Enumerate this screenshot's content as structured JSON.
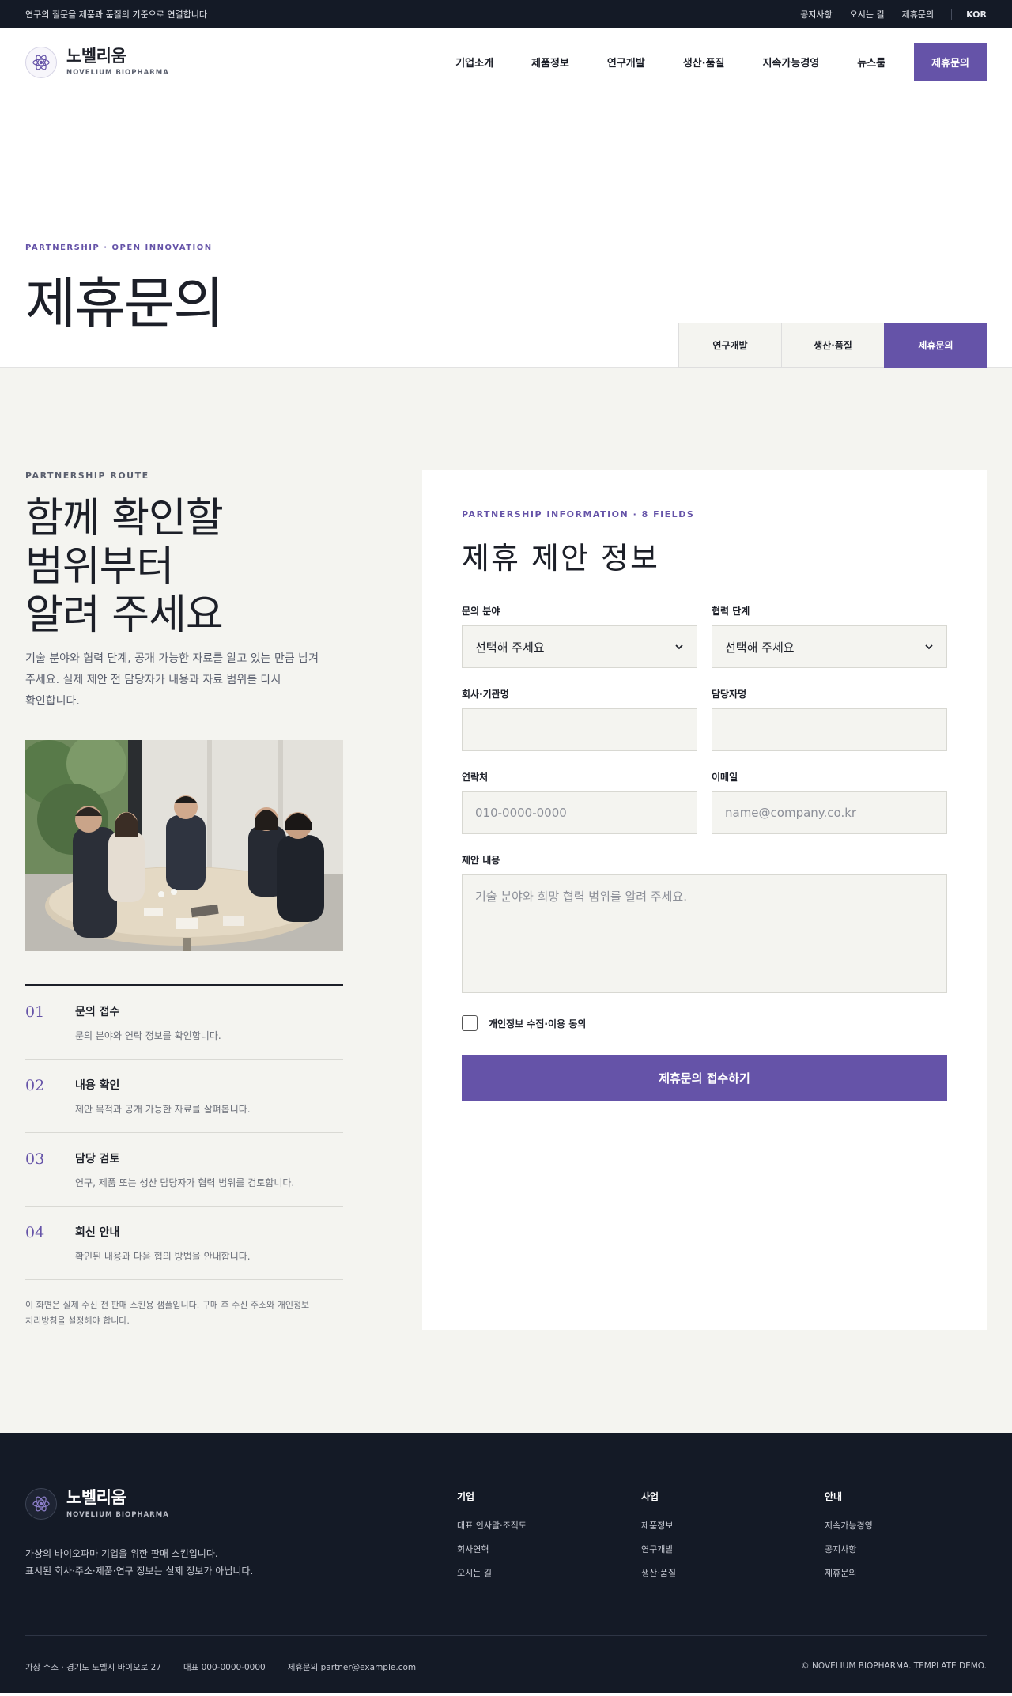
{
  "topbar": {
    "tagline": "연구의 질문을 제품과 품질의 기준으로 연결합니다",
    "links": [
      "공지사항",
      "오시는 길",
      "제휴문의"
    ],
    "lang": "KOR"
  },
  "header": {
    "brand_name": "노벨리움",
    "brand_sub": "NOVELIUM BIOPHARMA",
    "nav": [
      "기업소개",
      "제품정보",
      "연구개발",
      "생산·품질",
      "지속가능경영",
      "뉴스룸"
    ],
    "cta": "제휴문의"
  },
  "hero": {
    "eyebrow": "PARTNERSHIP · OPEN INNOVATION",
    "title": "제휴문의",
    "subtabs": [
      "연구개발",
      "생산·품질",
      "제휴문의"
    ]
  },
  "left": {
    "eyebrow": "PARTNERSHIP ROUTE",
    "heading_lines": [
      "함께 확인할",
      "범위부터",
      "알려 주세요"
    ],
    "desc_lines": [
      "기술 분야와 협력 단계, 공개 가능한 자료를 알고 있는 만큼 남겨",
      "주세요. 실제 제안 전 담당자가 내용과 자료 범위를 다시",
      "확인합니다."
    ],
    "steps": [
      {
        "num": "01",
        "title": "문의 접수",
        "text": "문의 분야와 연락 정보를 확인합니다."
      },
      {
        "num": "02",
        "title": "내용 확인",
        "text": "제안 목적과 공개 가능한 자료를 살펴봅니다."
      },
      {
        "num": "03",
        "title": "담당 검토",
        "text": "연구, 제품 또는 생산 담당자가 협력 범위를 검토합니다."
      },
      {
        "num": "04",
        "title": "회신 안내",
        "text": "확인된 내용과 다음 협의 방법을 안내합니다."
      }
    ],
    "note_lines": [
      "이 화면은 실제 수신 전 판매 스킨용 샘플입니다. 구매 후 수신 주소와 개인정보",
      "처리방침을 설정해야 합니다."
    ]
  },
  "form": {
    "eyebrow": "PARTNERSHIP INFORMATION · 8 FIELDS",
    "title": "제휴 제안 정보",
    "fields": {
      "category": {
        "label": "문의 분야",
        "value": "선택해 주세요"
      },
      "stage": {
        "label": "협력 단계",
        "value": "선택해 주세요"
      },
      "company": {
        "label": "회사·기관명",
        "value": ""
      },
      "manager": {
        "label": "담당자명",
        "value": ""
      },
      "phone": {
        "label": "연락처",
        "placeholder": "010-0000-0000"
      },
      "email": {
        "label": "이메일",
        "placeholder": "name@company.co.kr"
      },
      "message": {
        "label": "제안 내용",
        "placeholder": "기술 분야와 희망 협력 범위를 알려 주세요."
      }
    },
    "consent": "개인정보 수집·이용 동의",
    "submit": "제휴문의 접수하기"
  },
  "footer": {
    "brand_name": "노벨리움",
    "brand_sub": "NOVELIUM BIOPHARMA",
    "desc_lines": [
      "가상의 바이오파마 기업을 위한 판매 스킨입니다.",
      "표시된 회사·주소·제품·연구 정보는 실제 정보가 아닙니다."
    ],
    "columns": [
      {
        "title": "기업",
        "items": [
          "대표 인사말·조직도",
          "회사연혁",
          "오시는 길"
        ]
      },
      {
        "title": "사업",
        "items": [
          "제품정보",
          "연구개발",
          "생산·품질"
        ]
      },
      {
        "title": "안내",
        "items": [
          "지속가능경영",
          "공지사항",
          "제휴문의"
        ]
      }
    ],
    "address": "가상 주소 · 경기도 노벨시 바이오로 27",
    "phone": "대표 000-0000-0000",
    "email": "제휴문의 partner@example.com",
    "copyright": "© NOVELIUM BIOPHARMA. TEMPLATE DEMO."
  },
  "colors": {
    "accent": "#6553a8",
    "dark": "#141a26",
    "surface": "#f4f4f0"
  }
}
